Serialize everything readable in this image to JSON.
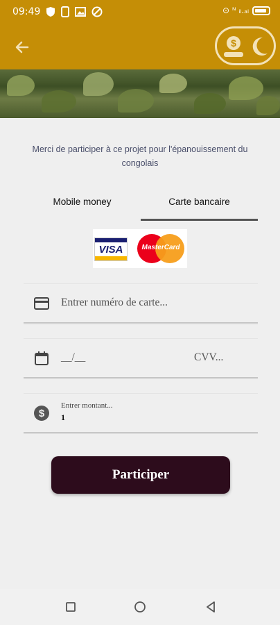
{
  "status_bar": {
    "time": "09:49",
    "right_text": "⊙ ᴺ ᵢₗ.ₐₗ"
  },
  "app_bar": {
    "back_icon": "arrow-left-icon",
    "coin_icon": "dollar-hand-icon",
    "moon_icon": "moon-icon",
    "accent_color": "#c58e06"
  },
  "intro": {
    "text": "Merci de participer à ce projet pour l'épanouissement du congolais"
  },
  "tabs": [
    {
      "label": "Mobile money",
      "selected": false
    },
    {
      "label": "Carte bancaire",
      "selected": true
    }
  ],
  "cards": {
    "visa_label": "VISA",
    "mastercard_label": "MasterCard"
  },
  "form": {
    "card_number_placeholder": "Entrer numéro de carte...",
    "expiry_placeholder": "__/__",
    "cvv_placeholder": "CVV...",
    "amount_placeholder": "Entrer montant...",
    "amount_value": "1"
  },
  "submit": {
    "label": "Participer",
    "color": "#2d0c1c"
  },
  "nav": {
    "recent_icon": "square-icon",
    "home_icon": "circle-icon",
    "back_icon": "triangle-back-icon"
  }
}
